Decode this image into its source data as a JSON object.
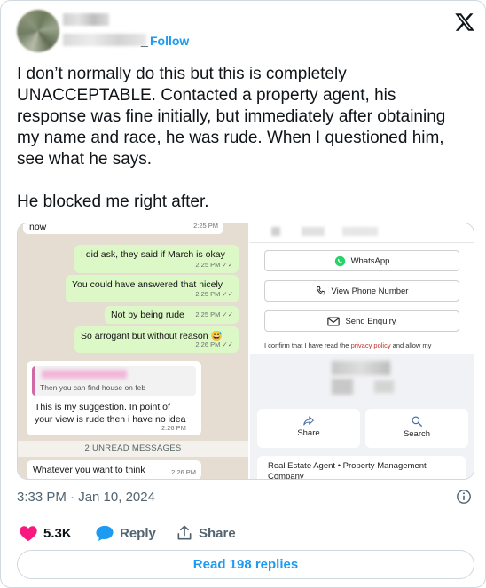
{
  "author": {
    "follow_label": "Follow",
    "handle_suffix": "_ ·"
  },
  "tweet": {
    "text": "I don’t normally do this but this is completely UNACCEPTABLE. Contacted a property agent, his response was fine initially, but immediately after obtaining my name and race, he was rude. When I questioned him, see what he says.\n\nHe blocked me right after."
  },
  "chat": {
    "top_partial": {
      "text": "now",
      "time": "2:25 PM"
    },
    "outgoing": [
      {
        "text": "I did ask, they said if March is okay",
        "time": "2:25 PM ✓✓"
      },
      {
        "text": "You could have answered that nicely",
        "time": "2:25 PM ✓✓"
      },
      {
        "text": "Not by being rude",
        "time": "2:25 PM ✓✓"
      },
      {
        "text": "So arrogant but without reason 😅",
        "time": "2:26 PM ✓✓"
      }
    ],
    "quote_text": "Then you can find house on feb",
    "incoming_reply": {
      "text": "This is my suggestion. In point of your view is rude then i have no idea",
      "time": "2:26 PM"
    },
    "unread_banner": "2 UNREAD MESSAGES",
    "last_incoming": {
      "text": "Whatever you want to think",
      "time": "2:26 PM"
    }
  },
  "listing_panel": {
    "whatsapp_label": "WhatsApp",
    "phone_label": "View Phone Number",
    "enquiry_label": "Send Enquiry",
    "consent_prefix": "I confirm that I have read the ",
    "consent_link": "privacy policy",
    "consent_suffix": " and allow my",
    "share_label": "Share",
    "search_label": "Search",
    "agent_title": "Real Estate Agent • Property Management Company"
  },
  "footer": {
    "timestamp": "3:33 PM · Jan 10, 2024",
    "likes": "5.3K",
    "reply_label": "Reply",
    "share_label": "Share",
    "read_replies": "Read 198 replies"
  },
  "colors": {
    "accent": "#1d9bf0",
    "like": "#f91880",
    "whatsapp": "#25d366",
    "chat_bg": "#e6ddd2",
    "outgoing_bubble": "#dcf8c6"
  },
  "icons": [
    "x-logo-icon",
    "whatsapp-icon",
    "phone-icon",
    "mail-icon",
    "share-icon",
    "search-icon",
    "info-icon",
    "heart-icon",
    "reply-icon",
    "share-upload-icon"
  ]
}
